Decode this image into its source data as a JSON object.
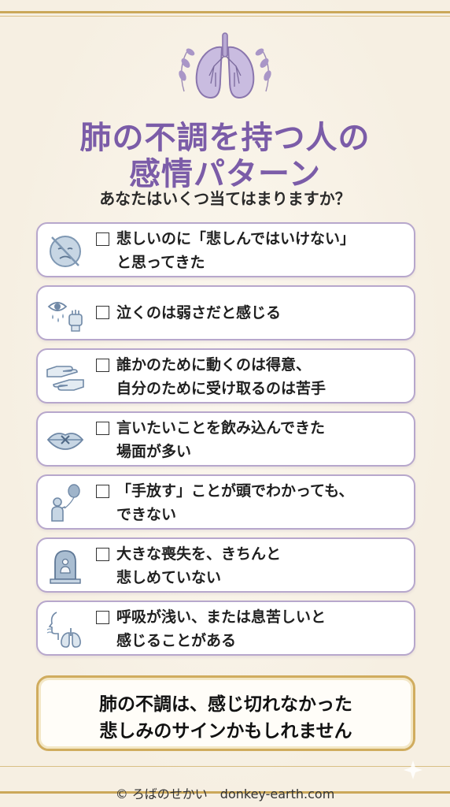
{
  "title": {
    "line1": "肺の不調を持つ人の",
    "line2": "感情パターン"
  },
  "subtitle": "あなたはいくつ当てはまりますか？",
  "checklist": [
    {
      "line1": "悲しいのに「悲しんではいけない」",
      "line2": "と思ってきた",
      "icon": "crossed-sad-face-icon"
    },
    {
      "line1": "泣くのは弱さだと感じる",
      "line2": "",
      "icon": "tear-eye-fist-icon"
    },
    {
      "line1": "誰かのために動くのは得意、",
      "line2": "自分のために受け取るのは苦手",
      "icon": "giving-hands-icon"
    },
    {
      "line1": "言いたいことを飲み込んできた",
      "line2": "場面が多い",
      "icon": "sealed-lips-icon"
    },
    {
      "line1": "「手放す」ことが頭でわかっても、",
      "line2": "できない",
      "icon": "person-balloon-icon"
    },
    {
      "line1": "大きな喪失を、きちんと",
      "line2": "悲しめていない",
      "icon": "gravestone-icon"
    },
    {
      "line1": "呼吸が浅い、または息苦しいと",
      "line2": "感じることがある",
      "icon": "breathing-lungs-icon"
    }
  ],
  "conclusion": {
    "line1": "肺の不調は、感じ切れなかった",
    "line2": "悲しみのサインかもしれません"
  },
  "footer": "© ろばのせかい　donkey-earth.com",
  "colors": {
    "background": "#f6efe2",
    "title": "#7b5ca8",
    "card_border": "#b7a7cc",
    "gold": "#cba85a",
    "icon_blue": "#8aa3be"
  }
}
